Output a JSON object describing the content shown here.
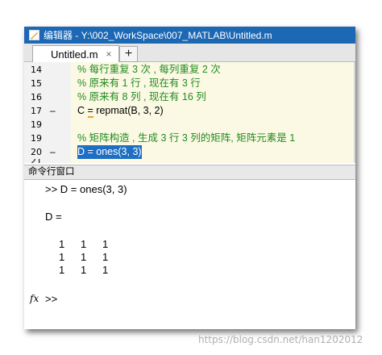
{
  "editor": {
    "title": "编辑器 - Y:\\002_WorkSpace\\007_MATLAB\\Untitled.m",
    "tab_label": "Untitled.m",
    "tab_close": "×",
    "new_tab": "+",
    "lines": [
      {
        "num": "14",
        "marker": "",
        "text": "% 每行重复 3 次 , 每列重复 2 次",
        "kind": "comment"
      },
      {
        "num": "15",
        "marker": "",
        "text": "% 原来有 1 行 , 现在有 3 行",
        "kind": "comment"
      },
      {
        "num": "16",
        "marker": "",
        "text": "% 原来有 8 列 , 现在有 16 列",
        "kind": "comment"
      },
      {
        "num": "17",
        "marker": "–",
        "text_pre": "C ",
        "text_eq": "=",
        "text_post": " repmat(B, 3, 2)",
        "kind": "code"
      },
      {
        "num": "19",
        "marker": "",
        "text": "",
        "kind": "blank"
      },
      {
        "num": "19",
        "marker": "",
        "text": "% 矩阵构造 , 生成 3 行 3 列的矩阵, 矩阵元素是 1",
        "kind": "comment"
      },
      {
        "num": "20",
        "marker": "–",
        "text": "D = ones(3, 3)",
        "kind": "selected"
      },
      {
        "num": "21",
        "marker": "",
        "text": "",
        "kind": "blank"
      }
    ]
  },
  "command_window": {
    "header": "命令行窗口",
    "command_line": ">> D = ones(3, 3)",
    "result_label": "D =",
    "matrix": [
      [
        "1",
        "1",
        "1"
      ],
      [
        "1",
        "1",
        "1"
      ],
      [
        "1",
        "1",
        "1"
      ]
    ],
    "fx_icon": "fx",
    "prompt": ">>"
  },
  "watermark": "https://blog.csdn.net/han1202012"
}
